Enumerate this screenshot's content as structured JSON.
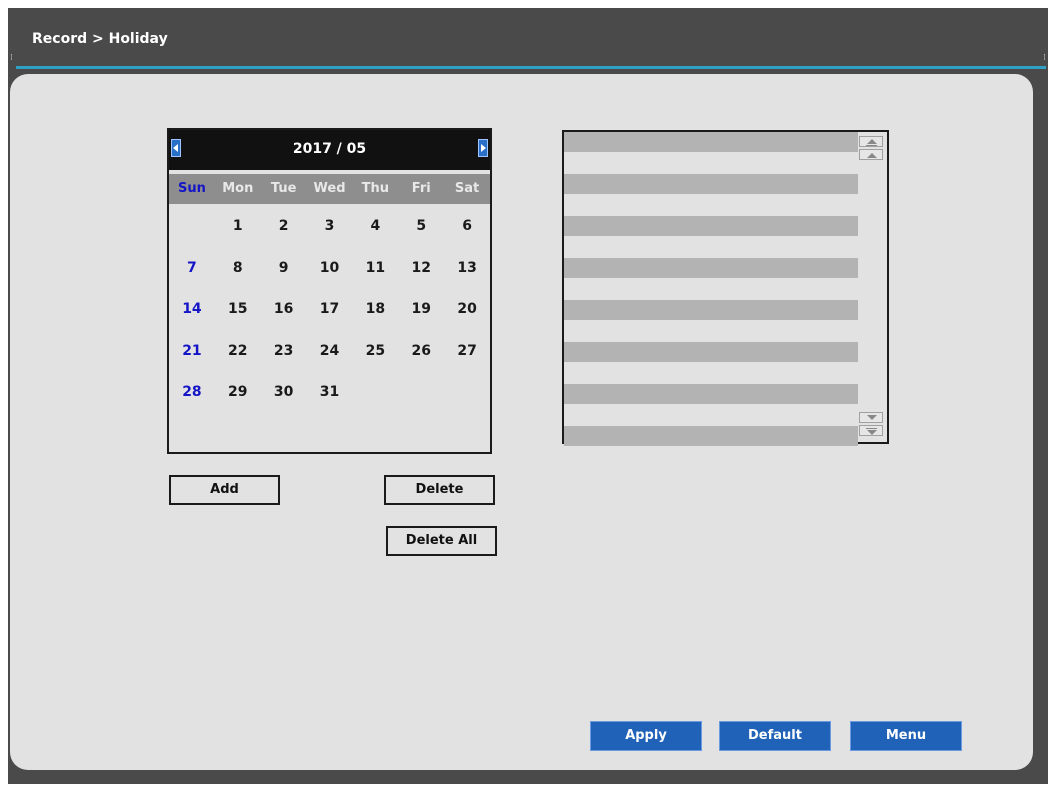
{
  "window": {
    "title": "Record > Holiday"
  },
  "calendar": {
    "month_label": "2017 / 05",
    "weekdays": [
      "Sun",
      "Mon",
      "Tue",
      "Wed",
      "Thu",
      "Fri",
      "Sat"
    ],
    "days": [
      "",
      "1",
      "2",
      "3",
      "4",
      "5",
      "6",
      "7",
      "8",
      "9",
      "10",
      "11",
      "12",
      "13",
      "14",
      "15",
      "16",
      "17",
      "18",
      "19",
      "20",
      "21",
      "22",
      "23",
      "24",
      "25",
      "26",
      "27",
      "28",
      "29",
      "30",
      "31",
      "",
      "",
      ""
    ],
    "prev_icon": "triangle-left-icon",
    "next_icon": "triangle-right-icon",
    "sunday_color": "#1515c8"
  },
  "actions": {
    "add": "Add",
    "delete": "Delete",
    "delete_all": "Delete All"
  },
  "footer": {
    "apply": "Apply",
    "default": "Default",
    "menu": "Menu"
  },
  "colors": {
    "accent_line": "#2f9fc6",
    "primary_button": "#1f62b8",
    "list_row": "#b3b3b3"
  }
}
